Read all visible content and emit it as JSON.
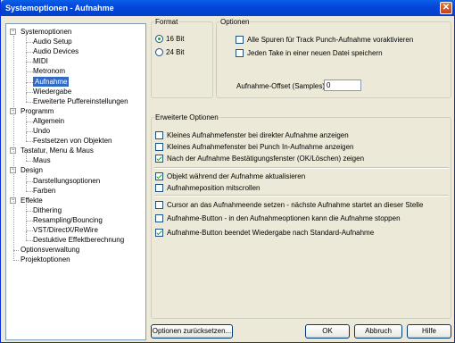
{
  "window": {
    "title": "Systemoptionen - Aufnahme",
    "close_glyph": "✕"
  },
  "tree": {
    "expander_open": "−",
    "nodes": [
      {
        "label": "Systemoptionen",
        "level": 0,
        "expandable": true
      },
      {
        "label": "Audio Setup",
        "level": 1
      },
      {
        "label": "Audio Devices",
        "level": 1
      },
      {
        "label": "MIDI",
        "level": 1
      },
      {
        "label": "Metronom",
        "level": 1
      },
      {
        "label": "Aufnahme",
        "level": 1,
        "selected": true
      },
      {
        "label": "Wiedergabe",
        "level": 1
      },
      {
        "label": "Erweiterte Puffereinstellungen",
        "level": 1
      },
      {
        "label": "Programm",
        "level": 0,
        "expandable": true
      },
      {
        "label": "Allgemein",
        "level": 1
      },
      {
        "label": "Undo",
        "level": 1
      },
      {
        "label": "Festsetzen von Objekten",
        "level": 1
      },
      {
        "label": "Tastatur, Menu & Maus",
        "level": 0,
        "expandable": true
      },
      {
        "label": "Maus",
        "level": 1
      },
      {
        "label": "Design",
        "level": 0,
        "expandable": true
      },
      {
        "label": "Darstellungsoptionen",
        "level": 1
      },
      {
        "label": "Farben",
        "level": 1
      },
      {
        "label": "Effekte",
        "level": 0,
        "expandable": true
      },
      {
        "label": "Dithering",
        "level": 1
      },
      {
        "label": "Resampling/Bouncing",
        "level": 1
      },
      {
        "label": "VST/DirectX/ReWire",
        "level": 1
      },
      {
        "label": "Destuktive Effektberechnung",
        "level": 1
      },
      {
        "label": "Optionsverwaltung",
        "level": 0
      },
      {
        "label": "Projektoptionen",
        "level": 0
      }
    ]
  },
  "format": {
    "legend": "Format",
    "options": [
      "16 Bit",
      "24 Bit"
    ],
    "selected": 0
  },
  "optionen": {
    "legend": "Optionen",
    "checkboxes": [
      {
        "label": "Alle Spuren für Track Punch-Aufnahme voraktivieren",
        "checked": false
      },
      {
        "label": "Jeden Take in einer neuen Datei speichern",
        "checked": false
      }
    ],
    "offset_label": "Aufnahme-Offset (Samples):",
    "offset_value": "0"
  },
  "erweitert": {
    "legend": "Erweiterte Optionen",
    "group1": [
      {
        "label": "Kleines Aufnahmefenster bei direkter Aufnahme anzeigen",
        "checked": false
      },
      {
        "label": "Kleines Aufnahmefenster bei Punch In-Aufnahme anzeigen",
        "checked": false
      },
      {
        "label": "Nach der Aufnahme Bestätigungsfenster (OK/Löschen) zeigen",
        "checked": true
      }
    ],
    "group2": [
      {
        "label": "Objekt während der Aufnahme aktualisieren",
        "checked": true
      },
      {
        "label": "Aufnahmeposition mitscrollen",
        "checked": false
      }
    ],
    "group3": [
      {
        "label": "Cursor an das Aufnahmeende setzen - nächste Aufnahme startet an dieser Stelle",
        "checked": false
      },
      {
        "label": "Aufnahme-Button -  in den Aufnahmeoptionen kann die Aufnahme stoppen",
        "checked": false
      },
      {
        "label": "Aufnahme-Button beendet Wiedergabe nach Standard-Aufnahme",
        "checked": true
      }
    ]
  },
  "buttons": {
    "reset": "Optionen zurücksetzen...",
    "ok": "OK",
    "cancel": "Abbruch",
    "help": "Hilfe"
  }
}
